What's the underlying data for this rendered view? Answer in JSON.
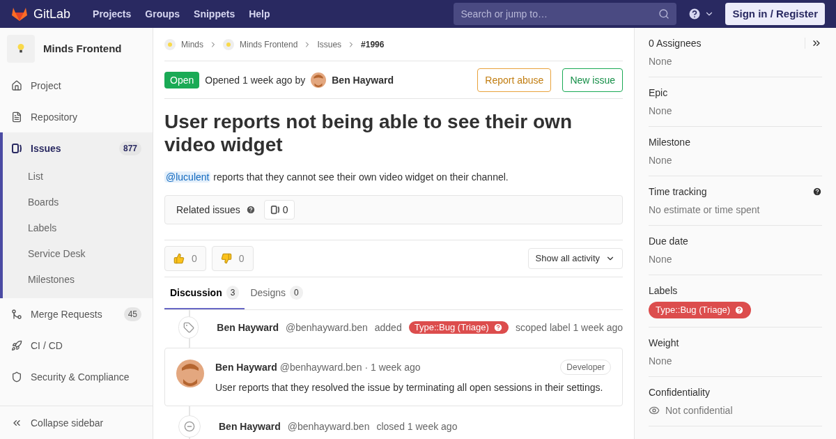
{
  "topbar": {
    "brand": "GitLab",
    "links": [
      "Projects",
      "Groups",
      "Snippets",
      "Help"
    ],
    "search": {
      "placeholder": "Search or jump to…"
    },
    "sign_in": "Sign in / Register"
  },
  "sidebar": {
    "project": "Minds Frontend",
    "items": [
      {
        "kind": "home",
        "label": "Project",
        "selected": false
      },
      {
        "kind": "repo",
        "label": "Repository",
        "selected": false
      },
      {
        "kind": "issues",
        "label": "Issues",
        "count": "877",
        "selected": true,
        "children": [
          {
            "label": "List",
            "selected": false
          },
          {
            "label": "Boards",
            "selected": false
          },
          {
            "label": "Labels",
            "selected": false
          },
          {
            "label": "Service Desk",
            "selected": false
          },
          {
            "label": "Milestones",
            "selected": false
          }
        ]
      },
      {
        "kind": "merge",
        "label": "Merge Requests",
        "count": "45",
        "selected": false
      },
      {
        "kind": "cicd",
        "label": "CI / CD",
        "selected": false
      },
      {
        "kind": "security",
        "label": "Security & Compliance",
        "selected": false
      }
    ],
    "collapse": "Collapse sidebar"
  },
  "breadcrumbs": [
    {
      "label": "Minds",
      "avatar": true,
      "current": false
    },
    {
      "label": "Minds Frontend",
      "avatar": true,
      "current": false
    },
    {
      "label": "Issues",
      "avatar": false,
      "current": false
    },
    {
      "label": "#1996",
      "avatar": false,
      "current": true
    }
  ],
  "issue": {
    "status": "Open",
    "opened": "Opened 1 week ago by",
    "author": "Ben Hayward",
    "report": "Report abuse",
    "new_issue": "New issue",
    "title": "User reports not being able to see their own video widget",
    "mention": "@luculent",
    "description": "reports that they cannot see their own video widget on their channel.",
    "related": {
      "label": "Related issues",
      "count": "0"
    },
    "thumbs_up": "0",
    "thumbs_down": "0",
    "activity": "Show all activity"
  },
  "tabs": [
    {
      "label": "Discussion",
      "count": "3",
      "selected": true
    },
    {
      "label": "Designs",
      "count": "0",
      "selected": false
    }
  ],
  "notes": [
    {
      "kind": "label_event",
      "author": "Ben Hayward",
      "handle": "@benhayward.ben",
      "action": "added",
      "label": "Type::Bug (Triage)",
      "rest": "scoped label 1 week ago"
    },
    {
      "kind": "comment",
      "author": "Ben Hayward",
      "handle": "@benhayward.ben",
      "time": "· 1 week ago",
      "role": "Developer",
      "body": "User reports that they resolved the issue by terminating all open sessions in their settings."
    },
    {
      "kind": "close_event",
      "author": "Ben Hayward",
      "handle": "@benhayward.ben",
      "action": "closed 1 week ago"
    }
  ],
  "right": [
    {
      "kind": "text",
      "title": "0 Assignees",
      "value": "None",
      "collapse": true,
      "help": false
    },
    {
      "kind": "text",
      "title": "Epic",
      "value": "None",
      "collapse": false,
      "help": false
    },
    {
      "kind": "text",
      "title": "Milestone",
      "value": "None",
      "collapse": false,
      "help": false
    },
    {
      "kind": "text",
      "title": "Time tracking",
      "value": "No estimate or time spent",
      "collapse": false,
      "help": true
    },
    {
      "kind": "text",
      "title": "Due date",
      "value": "None",
      "collapse": false,
      "help": false
    },
    {
      "kind": "labels",
      "title": "Labels",
      "labels": [
        {
          "text": "Type::Bug (Triage)",
          "color": "#dc4d4d"
        }
      ],
      "collapse": false,
      "help": false
    },
    {
      "kind": "text",
      "title": "Weight",
      "value": "None",
      "collapse": false,
      "help": false
    },
    {
      "kind": "confidential",
      "title": "Confidentiality",
      "value": "Not confidential",
      "collapse": false,
      "help": false
    }
  ]
}
